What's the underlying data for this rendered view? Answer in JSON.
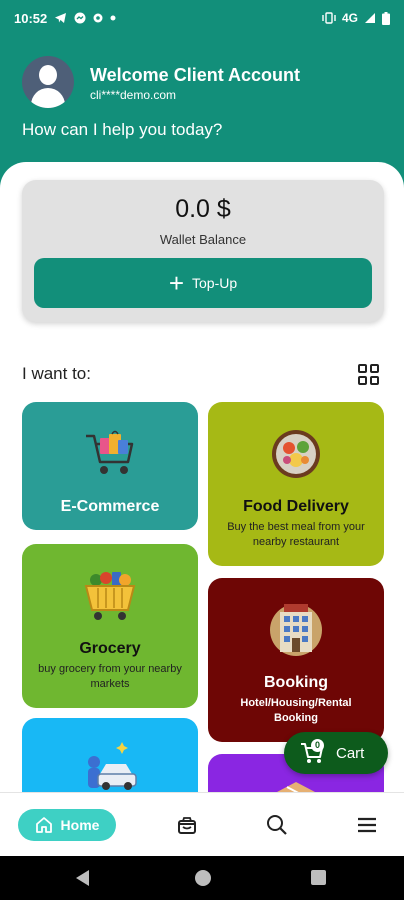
{
  "status_bar": {
    "time": "10:52",
    "network": "4G"
  },
  "header": {
    "welcome": "Welcome Client Account",
    "email": "cli****demo.com",
    "prompt": "How can I help you today?"
  },
  "wallet": {
    "amount": "0.0 $",
    "label": "Wallet Balance",
    "topup_label": "Top-Up"
  },
  "services": {
    "heading": "I want to:",
    "tiles": [
      {
        "title": "E-Commerce",
        "subtitle": ""
      },
      {
        "title": "Food Delivery",
        "subtitle": "Buy the best meal from your nearby restaurant"
      },
      {
        "title": "Grocery",
        "subtitle": "buy grocery from your nearby markets"
      },
      {
        "title": "Booking",
        "subtitle": "Hotel/Housing/Rental Booking"
      }
    ]
  },
  "cart": {
    "label": "Cart",
    "count": "0"
  },
  "bottom_nav": {
    "home_label": "Home",
    "items": [
      "home-icon",
      "bag-icon",
      "search-icon",
      "menu-icon"
    ]
  },
  "colors": {
    "primary": "#128f7a",
    "ecommerce": "#2a9d96",
    "food": "#a6b915",
    "grocery": "#6fb730",
    "booking": "#6e0605",
    "cart": "#0d5b1c",
    "home_pill": "#3ed0c4"
  }
}
